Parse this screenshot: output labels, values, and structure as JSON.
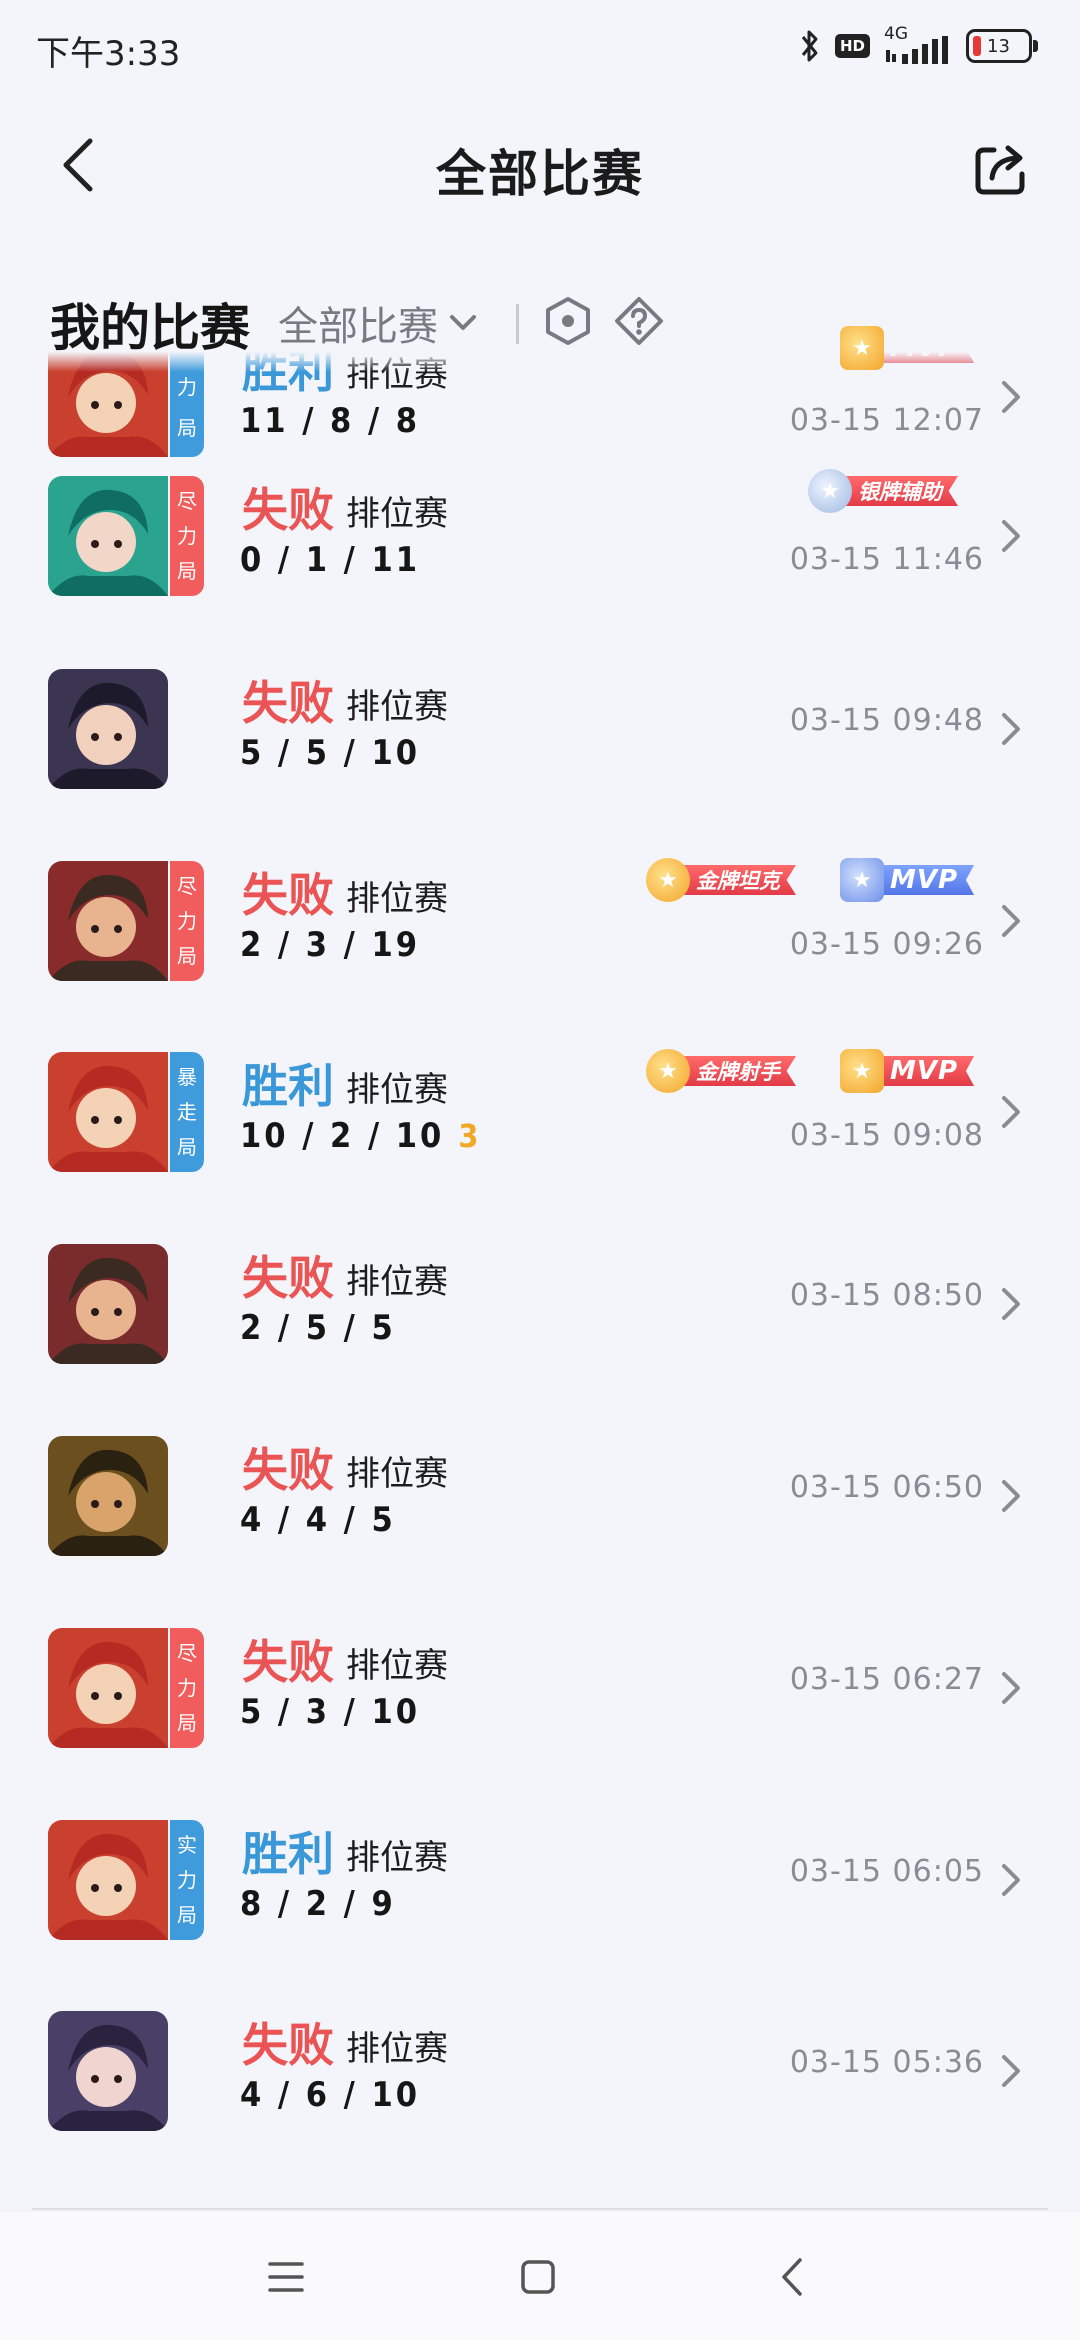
{
  "status_bar": {
    "time": "下午3:33",
    "hd": "HD",
    "network": "4G",
    "battery": "13"
  },
  "header": {
    "title": "全部比赛"
  },
  "section": {
    "title": "我的比赛",
    "filter": "全部比赛"
  },
  "colors": {
    "lose": "#eb5454",
    "win": "#3a98d8",
    "accent_gold": "#f0a826"
  },
  "matches": [
    {
      "result": "胜利",
      "mode": "排位赛",
      "kda": "11 / 8 / 8",
      "time": "03-15 12:07",
      "tag": [
        "",
        "力",
        "局"
      ],
      "badges": [
        {
          "label": "MVP"
        }
      ]
    },
    {
      "result": "失败",
      "mode": "排位赛",
      "kda": "0 / 1 / 11",
      "time": "03-15 11:46",
      "tag": [
        "尽",
        "力",
        "局"
      ],
      "badges": [
        {
          "label": "银牌辅助"
        }
      ]
    },
    {
      "result": "失败",
      "mode": "排位赛",
      "kda": "5 / 5 / 10",
      "time": "03-15 09:48"
    },
    {
      "result": "失败",
      "mode": "排位赛",
      "kda": "2 / 3 / 19",
      "time": "03-15 09:26",
      "tag": [
        "尽",
        "力",
        "局"
      ],
      "badges": [
        {
          "label": "金牌坦克"
        },
        {
          "label": "MVP"
        }
      ]
    },
    {
      "result": "胜利",
      "mode": "排位赛",
      "kda": "10 / 2 / 10",
      "streak": "3",
      "time": "03-15 09:08",
      "tag": [
        "暴",
        "走",
        "局"
      ],
      "badges": [
        {
          "label": "金牌射手"
        },
        {
          "label": "MVP"
        }
      ]
    },
    {
      "result": "失败",
      "mode": "排位赛",
      "kda": "2 / 5 / 5",
      "time": "03-15 08:50"
    },
    {
      "result": "失败",
      "mode": "排位赛",
      "kda": "4 / 4 / 5",
      "time": "03-15 06:50"
    },
    {
      "result": "失败",
      "mode": "排位赛",
      "kda": "5 / 3 / 10",
      "time": "03-15 06:27",
      "tag": [
        "尽",
        "力",
        "局"
      ]
    },
    {
      "result": "胜利",
      "mode": "排位赛",
      "kda": "8 / 2 / 9",
      "time": "03-15 06:05",
      "tag": [
        "实",
        "力",
        "局"
      ]
    },
    {
      "result": "失败",
      "mode": "排位赛",
      "kda": "4 / 6 / 10",
      "time": "03-15 05:36"
    }
  ]
}
